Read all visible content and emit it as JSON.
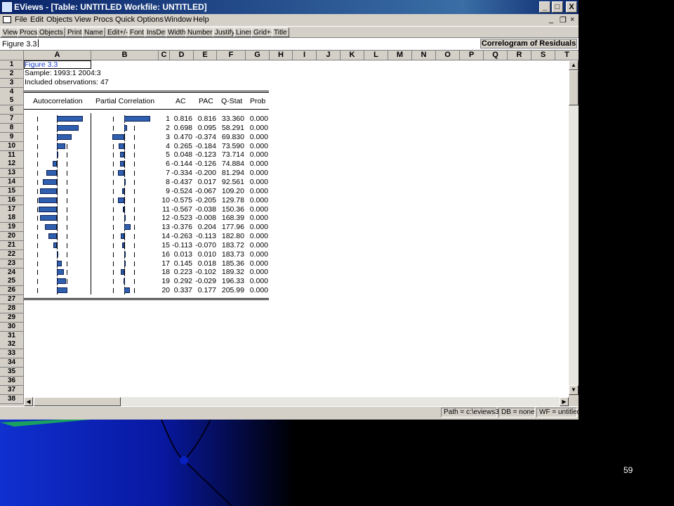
{
  "window": {
    "title": "EViews - [Table: UNTITLED    Workfile: UNTITLED]",
    "controls": {
      "minimize": "_",
      "maximize": "□",
      "close": "X"
    }
  },
  "menu": [
    "File",
    "Edit",
    "Objects",
    "View",
    "Procs",
    "Quick",
    "Options",
    "Window",
    "Help"
  ],
  "menu_doc_controls": {
    "minimize": "_",
    "restore": "❐",
    "close": "×"
  },
  "toolbar": [
    "View",
    "Procs",
    "Objects",
    "Print",
    "Name",
    "Edit+/-",
    "Font",
    "InsDel",
    "Width",
    "Numbers",
    "Justify",
    "Lines",
    "Grid+-",
    "Title"
  ],
  "edit_field": {
    "value": "Figure 3.3"
  },
  "table_title": "Correlogram of Residuals",
  "columns": [
    "A",
    "B",
    "C",
    "D",
    "E",
    "F",
    "G",
    "H",
    "I",
    "J",
    "K",
    "L",
    "M",
    "N",
    "O",
    "P",
    "Q",
    "R",
    "S",
    "T"
  ],
  "rows": [
    "1",
    "2",
    "3",
    "4",
    "5",
    "6",
    "7",
    "8",
    "9",
    "10",
    "11",
    "12",
    "13",
    "14",
    "15",
    "16",
    "17",
    "18",
    "19",
    "20",
    "21",
    "22",
    "23",
    "24",
    "25",
    "26",
    "27",
    "28",
    "29",
    "30",
    "31",
    "32",
    "33",
    "34",
    "35",
    "36",
    "37",
    "38"
  ],
  "header_info": {
    "figure": "Figure 3.3",
    "sample": "Sample: 1993:1 2004:3",
    "included": "Included observations: 47"
  },
  "table_headers": {
    "autocorrelation": "Autocorrelation",
    "partial": "Partial Correlation",
    "ac": "AC",
    "pac": "PAC",
    "qstat": "Q-Stat",
    "prob": "Prob"
  },
  "correlogram": [
    {
      "lag": "1",
      "ac": "0.816",
      "pac": "0.816",
      "q": "33.360",
      "p": "0.000",
      "acv": 0.816,
      "pacv": 0.816
    },
    {
      "lag": "2",
      "ac": "0.698",
      "pac": "0.095",
      "q": "58.291",
      "p": "0.000",
      "acv": 0.698,
      "pacv": 0.095
    },
    {
      "lag": "3",
      "ac": "0.470",
      "pac": "-0.374",
      "q": "69.830",
      "p": "0.000",
      "acv": 0.47,
      "pacv": -0.374
    },
    {
      "lag": "4",
      "ac": "0.265",
      "pac": "-0.184",
      "q": "73.590",
      "p": "0.000",
      "acv": 0.265,
      "pacv": -0.184
    },
    {
      "lag": "5",
      "ac": "0.048",
      "pac": "-0.123",
      "q": "73.714",
      "p": "0.000",
      "acv": 0.048,
      "pacv": -0.123
    },
    {
      "lag": "6",
      "ac": "-0.144",
      "pac": "-0.126",
      "q": "74.884",
      "p": "0.000",
      "acv": -0.144,
      "pacv": -0.126
    },
    {
      "lag": "7",
      "ac": "-0.334",
      "pac": "-0.200",
      "q": "81.294",
      "p": "0.000",
      "acv": -0.334,
      "pacv": -0.2
    },
    {
      "lag": "8",
      "ac": "-0.437",
      "pac": "0.017",
      "q": "92.561",
      "p": "0.000",
      "acv": -0.437,
      "pacv": 0.017
    },
    {
      "lag": "9",
      "ac": "-0.524",
      "pac": "-0.067",
      "q": "109.20",
      "p": "0.000",
      "acv": -0.524,
      "pacv": -0.067
    },
    {
      "lag": "10",
      "ac": "-0.575",
      "pac": "-0.205",
      "q": "129.78",
      "p": "0.000",
      "acv": -0.575,
      "pacv": -0.205
    },
    {
      "lag": "11",
      "ac": "-0.567",
      "pac": "-0.038",
      "q": "150.36",
      "p": "0.000",
      "acv": -0.567,
      "pacv": -0.038
    },
    {
      "lag": "12",
      "ac": "-0.523",
      "pac": "-0.008",
      "q": "168.39",
      "p": "0.000",
      "acv": -0.523,
      "pacv": -0.008
    },
    {
      "lag": "13",
      "ac": "-0.376",
      "pac": "0.204",
      "q": "177.96",
      "p": "0.000",
      "acv": -0.376,
      "pacv": 0.204
    },
    {
      "lag": "14",
      "ac": "-0.263",
      "pac": "-0.113",
      "q": "182.80",
      "p": "0.000",
      "acv": -0.263,
      "pacv": -0.113
    },
    {
      "lag": "15",
      "ac": "-0.113",
      "pac": "-0.070",
      "q": "183.72",
      "p": "0.000",
      "acv": -0.113,
      "pacv": -0.07
    },
    {
      "lag": "16",
      "ac": "0.013",
      "pac": "0.010",
      "q": "183.73",
      "p": "0.000",
      "acv": 0.013,
      "pacv": 0.01
    },
    {
      "lag": "17",
      "ac": "0.145",
      "pac": "0.018",
      "q": "185.36",
      "p": "0.000",
      "acv": 0.145,
      "pacv": 0.018
    },
    {
      "lag": "18",
      "ac": "0.223",
      "pac": "-0.102",
      "q": "189.32",
      "p": "0.000",
      "acv": 0.223,
      "pacv": -0.102
    },
    {
      "lag": "19",
      "ac": "0.292",
      "pac": "-0.029",
      "q": "196.33",
      "p": "0.000",
      "acv": 0.292,
      "pacv": -0.029
    },
    {
      "lag": "20",
      "ac": "0.337",
      "pac": "0.177",
      "q": "205.99",
      "p": "0.000",
      "acv": 0.337,
      "pacv": 0.177
    }
  ],
  "status": {
    "path": "Path = c:\\eviews3",
    "db": "DB = none",
    "wf": "WF = untitled"
  },
  "slide_number": "59",
  "colors": {
    "bar_fill": "#2f5fb0",
    "title_bar": "#0a246a",
    "link_text": "#1a3fd0"
  }
}
